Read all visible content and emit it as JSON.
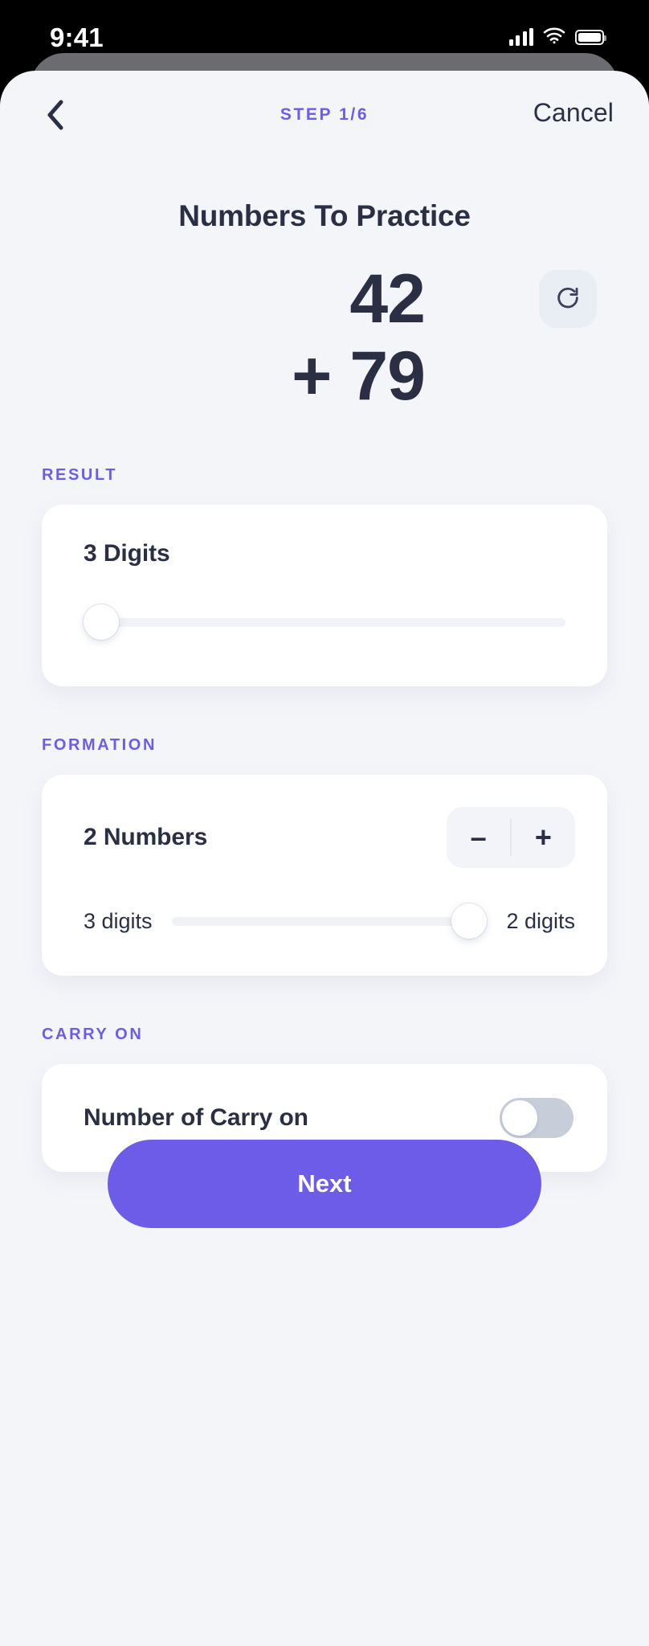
{
  "status_bar": {
    "time": "9:41",
    "signal_icon": "cellular-signal-icon",
    "wifi_icon": "wifi-icon",
    "battery_icon": "battery-icon"
  },
  "nav": {
    "back_icon": "back-chevron-icon",
    "step_label": "STEP 1/6",
    "cancel_label": "Cancel"
  },
  "header": {
    "title": "Numbers To Practice"
  },
  "equation": {
    "operand_top": "42",
    "operator": "+",
    "operand_bottom": "79",
    "refresh_icon": "refresh-icon"
  },
  "result": {
    "section_label": "RESULT",
    "value_label": "3 Digits",
    "slider_position_percent": 0
  },
  "formation": {
    "section_label": "FORMATION",
    "value_label": "2 Numbers",
    "decrement_label": "–",
    "increment_label": "+",
    "slider_left_label": "3 digits",
    "slider_right_label": "2 digits",
    "slider_position_percent": 100
  },
  "carry": {
    "section_label": "CARRY ON",
    "toggle_label": "Number of Carry on",
    "toggle_state": "off"
  },
  "footer": {
    "next_label": "Next"
  },
  "colors": {
    "accent": "#6c5ce7",
    "text_dark": "#2b2f44",
    "sheet_background": "#f4f5f9",
    "card_background": "#ffffff",
    "control_background": "#f2f4f9",
    "toggle_off": "#c8cdda"
  }
}
